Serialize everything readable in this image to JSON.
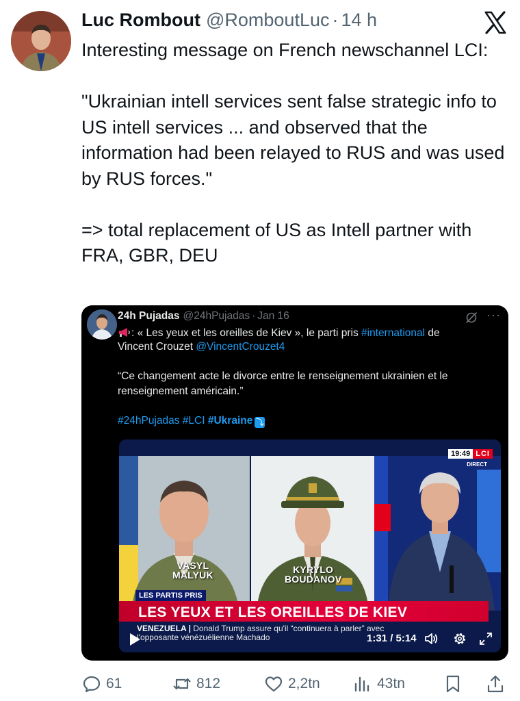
{
  "post": {
    "author_name": "Luc Rombout",
    "author_handle": "@RomboutLuc",
    "separator": "·",
    "time": "14 h",
    "text": "Interesting message on French newschannel LCI:\n\n\"Ukrainian intell services sent false strategic info to US intell services ... and observed that the information had been relayed to RUS and was used by RUS forces.\"\n\n=> total replacement of US as Intell partner with FRA, GBR, DEU"
  },
  "embedded": {
    "author_name": "24h Pujadas",
    "author_handle": "@24hPujadas",
    "separator": "·",
    "date": "Jan 16",
    "more": "···",
    "line1_text": ": « Les yeux et les oreilles de Kiev », le parti pris ",
    "line1_hashtag": "#international",
    "line1_end": " de",
    "line2_text": "Vincent Crouzet ",
    "line2_mention": "@VincentCrouzet4",
    "quote_line1": "“Ce changement acte le divorce entre le renseignement ukrainien et le",
    "quote_line2": "renseignement américain.”",
    "hashtags_1": "#24hPujadas #LCI ",
    "hashtags_2": "#Ukraine",
    "arrow": "⤵"
  },
  "video": {
    "caption_left_1": "VASYL",
    "caption_left_2": "MALYUK",
    "caption_mid_1": "KYRYLO",
    "caption_mid_2": "BOUDANOV",
    "clock": "19:49",
    "channel": "LCI",
    "live_label": "DIRECT",
    "tag": "LES PARTIS PRIS",
    "headline": "LES YEUX ET LES OREILLES DE KIEV",
    "ticker_bold": "VENEZUELA |",
    "ticker_line1": " Donald Trump assure qu'il “continuera à parler” avec",
    "ticker_line2": "l'opposante vénézuélienne Machado",
    "playback_time": "1:31 / 5:14"
  },
  "actions": {
    "replies": "61",
    "reposts": "812",
    "likes": "2,2tn",
    "views": "43tn"
  },
  "icons": [
    "x-logo-icon",
    "grok-icon",
    "megaphone-icon",
    "play-icon",
    "volume-icon",
    "settings-gear-icon",
    "fullscreen-icon",
    "reply-icon",
    "repost-icon",
    "like-heart-icon",
    "views-icon",
    "bookmark-icon",
    "share-icon"
  ],
  "colors": {
    "link": "#1d9bf0",
    "muted": "#536471",
    "text": "#0f1419",
    "embed_bg": "#000000",
    "lci_red": "#e3001b"
  }
}
